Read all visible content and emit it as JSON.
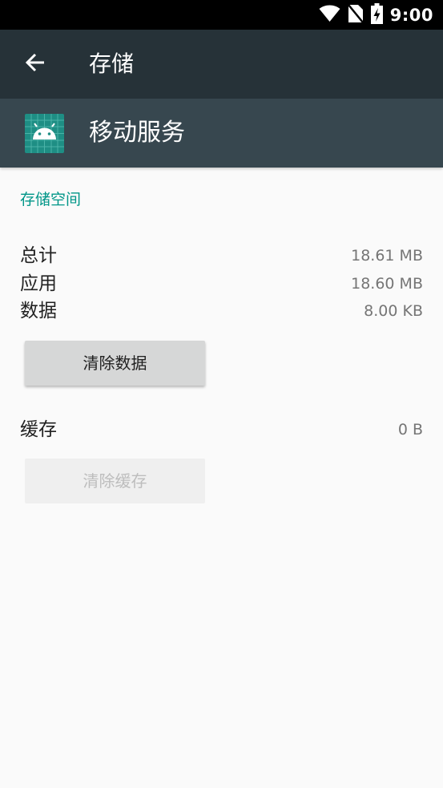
{
  "status_bar": {
    "time": "9:00",
    "icons": [
      "wifi-icon",
      "no-sim-icon",
      "battery-charging-icon"
    ]
  },
  "toolbar": {
    "back_icon": "arrow-back-icon",
    "title": "存储"
  },
  "app_header": {
    "icon": "android-icon",
    "name": "移动服务"
  },
  "storage": {
    "section_title": "存储空间",
    "total": {
      "label": "总计",
      "value": "18.61 MB"
    },
    "app": {
      "label": "应用",
      "value": "18.60 MB"
    },
    "data": {
      "label": "数据",
      "value": "8.00 KB"
    },
    "clear_data_button": "清除数据",
    "cache": {
      "label": "缓存",
      "value": "0 B"
    },
    "clear_cache_button": "清除缓存"
  },
  "colors": {
    "status_bar": "#000000",
    "toolbar": "#263238",
    "app_header": "#37474f",
    "accent": "#009688",
    "background": "#fafafa"
  }
}
